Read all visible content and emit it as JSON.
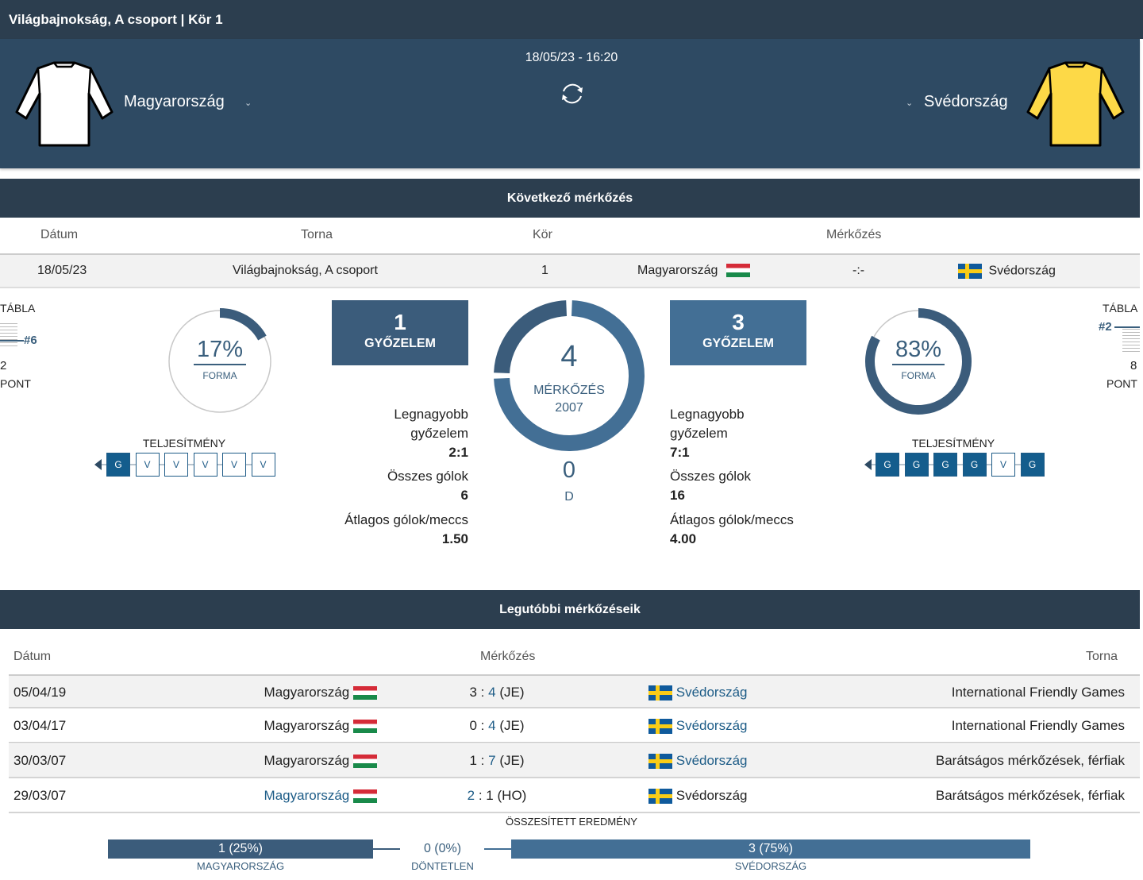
{
  "header": {
    "title": "Világbajnokság, A csoport | Kör 1"
  },
  "match": {
    "datetime": "18/05/23 - 16:20",
    "home": {
      "name": "Magyarország",
      "shirt_color": "#ffffff"
    },
    "away": {
      "name": "Svédország",
      "shirt_color": "#fdd947"
    }
  },
  "next_match": {
    "section_title": "Következő mérkőzés",
    "columns": {
      "date": "Dátum",
      "tournament": "Torna",
      "round": "Kör",
      "match": "Mérkőzés"
    },
    "row": {
      "date": "18/05/23",
      "tournament": "Világbajnokság, A csoport",
      "round": "1",
      "home": "Magyarország",
      "score": "-:-",
      "away": "Svédország"
    }
  },
  "stats": {
    "home": {
      "table_label": "TÁBLA",
      "table_rank": "#6",
      "points": "2",
      "points_label": "PONT",
      "form_pct": "17%",
      "form_value": 0.17,
      "form_label": "FORMA",
      "perf_label": "TELJESÍTMÉNY",
      "perf": [
        "G",
        "V",
        "V",
        "V",
        "V",
        "V"
      ],
      "wins": "1",
      "wins_label": "GYŐZELEM",
      "biggest_win_label_1": "Legnagyobb",
      "biggest_win_label_2": "győzelem",
      "biggest_win": "2:1",
      "total_goals_label": "Összes gólok",
      "total_goals": "6",
      "avg_goals_label": "Átlagos gólok/meccs",
      "avg_goals": "1.50"
    },
    "away": {
      "table_label": "TÁBLA",
      "table_rank": "#2",
      "points": "8",
      "points_label": "PONT",
      "form_pct": "83%",
      "form_value": 0.83,
      "form_label": "FORMA",
      "perf_label": "TELJESÍTMÉNY",
      "perf": [
        "G",
        "G",
        "G",
        "G",
        "V",
        "G"
      ],
      "wins": "3",
      "wins_label": "GYŐZELEM",
      "biggest_win_label_1": "Legnagyobb",
      "biggest_win_label_2": "győzelem",
      "biggest_win": "7:1",
      "total_goals_label": "Összes gólok",
      "total_goals": "16",
      "avg_goals_label": "Átlagos gólok/meccs",
      "avg_goals": "4.00"
    },
    "h2h": {
      "matches": "4",
      "matches_label": "MÉRKŐZÉS",
      "since": "2007",
      "draws": "0",
      "draws_label": "D",
      "home_share": 0.25,
      "away_share": 0.75
    }
  },
  "recent": {
    "section_title": "Legutóbbi mérkőzéseik",
    "columns": {
      "date": "Dátum",
      "match": "Mérkőzés",
      "tournament": "Torna"
    },
    "rows": [
      {
        "date": "05/04/19",
        "home": "Magyarország",
        "home_score": "3",
        "away_score": "4",
        "result": "(JE)",
        "away": "Svédország",
        "tournament": "International Friendly Games",
        "winner": "away"
      },
      {
        "date": "03/04/17",
        "home": "Magyarország",
        "home_score": "0",
        "away_score": "4",
        "result": "(JE)",
        "away": "Svédország",
        "tournament": "International Friendly Games",
        "winner": "away"
      },
      {
        "date": "30/03/07",
        "home": "Magyarország",
        "home_score": "1",
        "away_score": "7",
        "result": "(JE)",
        "away": "Svédország",
        "tournament": "Barátságos mérkőzések, férfiak",
        "winner": "away"
      },
      {
        "date": "29/03/07",
        "home": "Magyarország",
        "home_score": "2",
        "away_score": "1",
        "result": "(HO)",
        "away": "Svédország",
        "tournament": "Barátságos mérkőzések, férfiak",
        "winner": "home"
      }
    ],
    "aggregate": {
      "title": "ÖSSZESÍTETT EREDMÉNY",
      "home_value": "1 (25%)",
      "home_label": "MAGYARORSZÁG",
      "draw_value": "0 (0%)",
      "draw_label": "DÖNTETLEN",
      "away_value": "3 (75%)",
      "away_label": "SVÉDORSZÁG"
    }
  },
  "colors": {
    "dark_header": "#2c3e4f",
    "hero": "#2e4a63",
    "home_accent": "#3b5c7b",
    "away_accent": "#436f95",
    "link": "#1d5c87"
  }
}
